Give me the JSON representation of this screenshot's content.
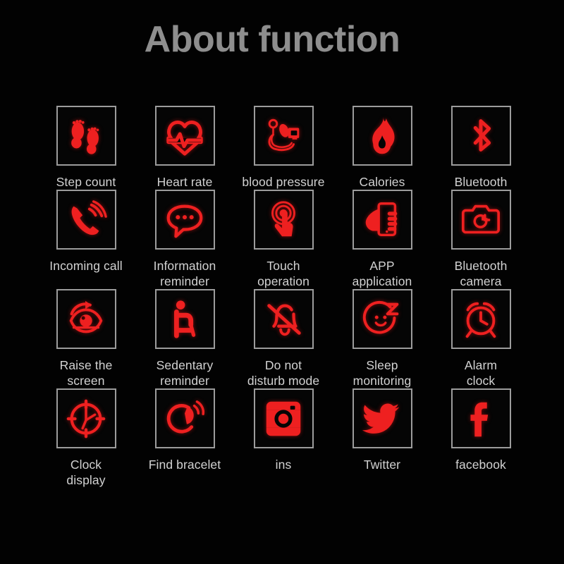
{
  "page": {
    "title": "About function",
    "background_color": "#000000",
    "title_color": "#8e8e8e",
    "icon_color": "#ee2020",
    "box_border_color": "#9c9c9c",
    "label_color": "#d2d2d2"
  },
  "grid": {
    "columns": 5,
    "rows": 4,
    "items": [
      {
        "label": "Step count",
        "icon": "footprints-icon"
      },
      {
        "label": "Heart rate",
        "icon": "heart-pulse-icon"
      },
      {
        "label": "blood pressure",
        "icon": "blood-pressure-cuff-icon"
      },
      {
        "label": "Calories",
        "icon": "flame-icon"
      },
      {
        "label": "Bluetooth",
        "icon": "bluetooth-icon"
      },
      {
        "label": "Incoming call",
        "icon": "phone-ringing-icon"
      },
      {
        "label": "Information\nreminder",
        "icon": "speech-bubble-dots-icon"
      },
      {
        "label": "Touch\noperation",
        "icon": "touch-hand-ripple-icon"
      },
      {
        "label": "APP\napplication",
        "icon": "hand-holding-phone-icon"
      },
      {
        "label": "Bluetooth\ncamera",
        "icon": "camera-icon"
      },
      {
        "label": "Raise the\nscreen",
        "icon": "eye-rotate-arrow-icon"
      },
      {
        "label": "Sedentary\nreminder",
        "icon": "seated-person-icon"
      },
      {
        "label": "Do not\ndisturb mode",
        "icon": "bell-slash-icon"
      },
      {
        "label": "Sleep\nmonitoring",
        "icon": "sleeping-face-z-icon"
      },
      {
        "label": "Alarm\nclock",
        "icon": "alarm-clock-icon"
      },
      {
        "label": "Clock\ndisplay",
        "icon": "clock-face-icon"
      },
      {
        "label": "Find bracelet",
        "icon": "bracelet-signal-icon"
      },
      {
        "label": "ins",
        "icon": "instagram-icon"
      },
      {
        "label": "Twitter",
        "icon": "twitter-bird-icon"
      },
      {
        "label": "facebook",
        "icon": "facebook-f-icon"
      }
    ]
  }
}
